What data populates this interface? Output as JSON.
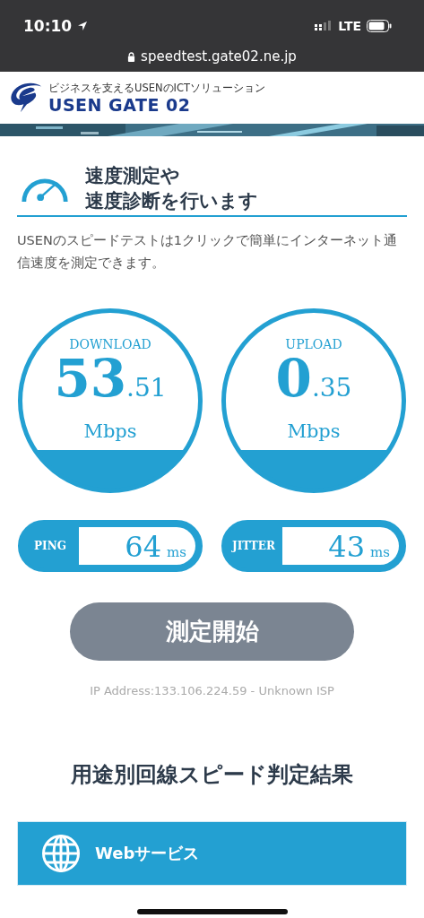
{
  "status_bar": {
    "time": "10:10",
    "network": "LTE"
  },
  "browser": {
    "url": "speedtest.gate02.ne.jp"
  },
  "header": {
    "tagline": "ビジネスを支えるUSENのICTソリューション",
    "logo_text": "USEN GATE 02"
  },
  "intro": {
    "title_lines": [
      "速度測定や",
      "速度診断を行います"
    ],
    "description": "USENのスピードテストは1クリックで簡単にインターネット通信速度を測定できます。"
  },
  "speeds": [
    {
      "label": "DOWNLOAD",
      "integer": "53",
      "decimal": ".51",
      "unit": "Mbps"
    },
    {
      "label": "UPLOAD",
      "integer": "0",
      "decimal": ".35",
      "unit": "Mbps"
    }
  ],
  "latency": [
    {
      "label": "PING",
      "value": "64",
      "unit": "ms"
    },
    {
      "label": "JITTER",
      "value": "43",
      "unit": "ms"
    }
  ],
  "start_button": {
    "label": "測定開始",
    "disabled": true
  },
  "ip_info": "IP Address:133.106.224.59 - Unknown ISP",
  "results": {
    "title": "用途別回線スピード判定結果",
    "cards": [
      {
        "title": "Webサービス"
      }
    ]
  }
}
